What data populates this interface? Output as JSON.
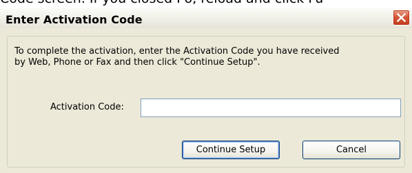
{
  "background": {
    "cropped_text": "Code screen. If you closed F6, reload and click Fu"
  },
  "dialog": {
    "title": "Enter Activation Code",
    "instructions_line1": "To complete the activation, enter the Activation Code you have received",
    "instructions_line2": "by Web, Phone or Fax and then click \"Continue Setup\".",
    "code_label": "Activation Code:",
    "code_value": "",
    "continue_button": "Continue Setup",
    "cancel_button": "Cancel"
  },
  "colors": {
    "dialog_bg": "#ece9d8",
    "close_button": "#d85a3a",
    "input_border": "#7f9db9",
    "button_border": "#003c74"
  },
  "icons": {
    "close": "close-icon"
  }
}
